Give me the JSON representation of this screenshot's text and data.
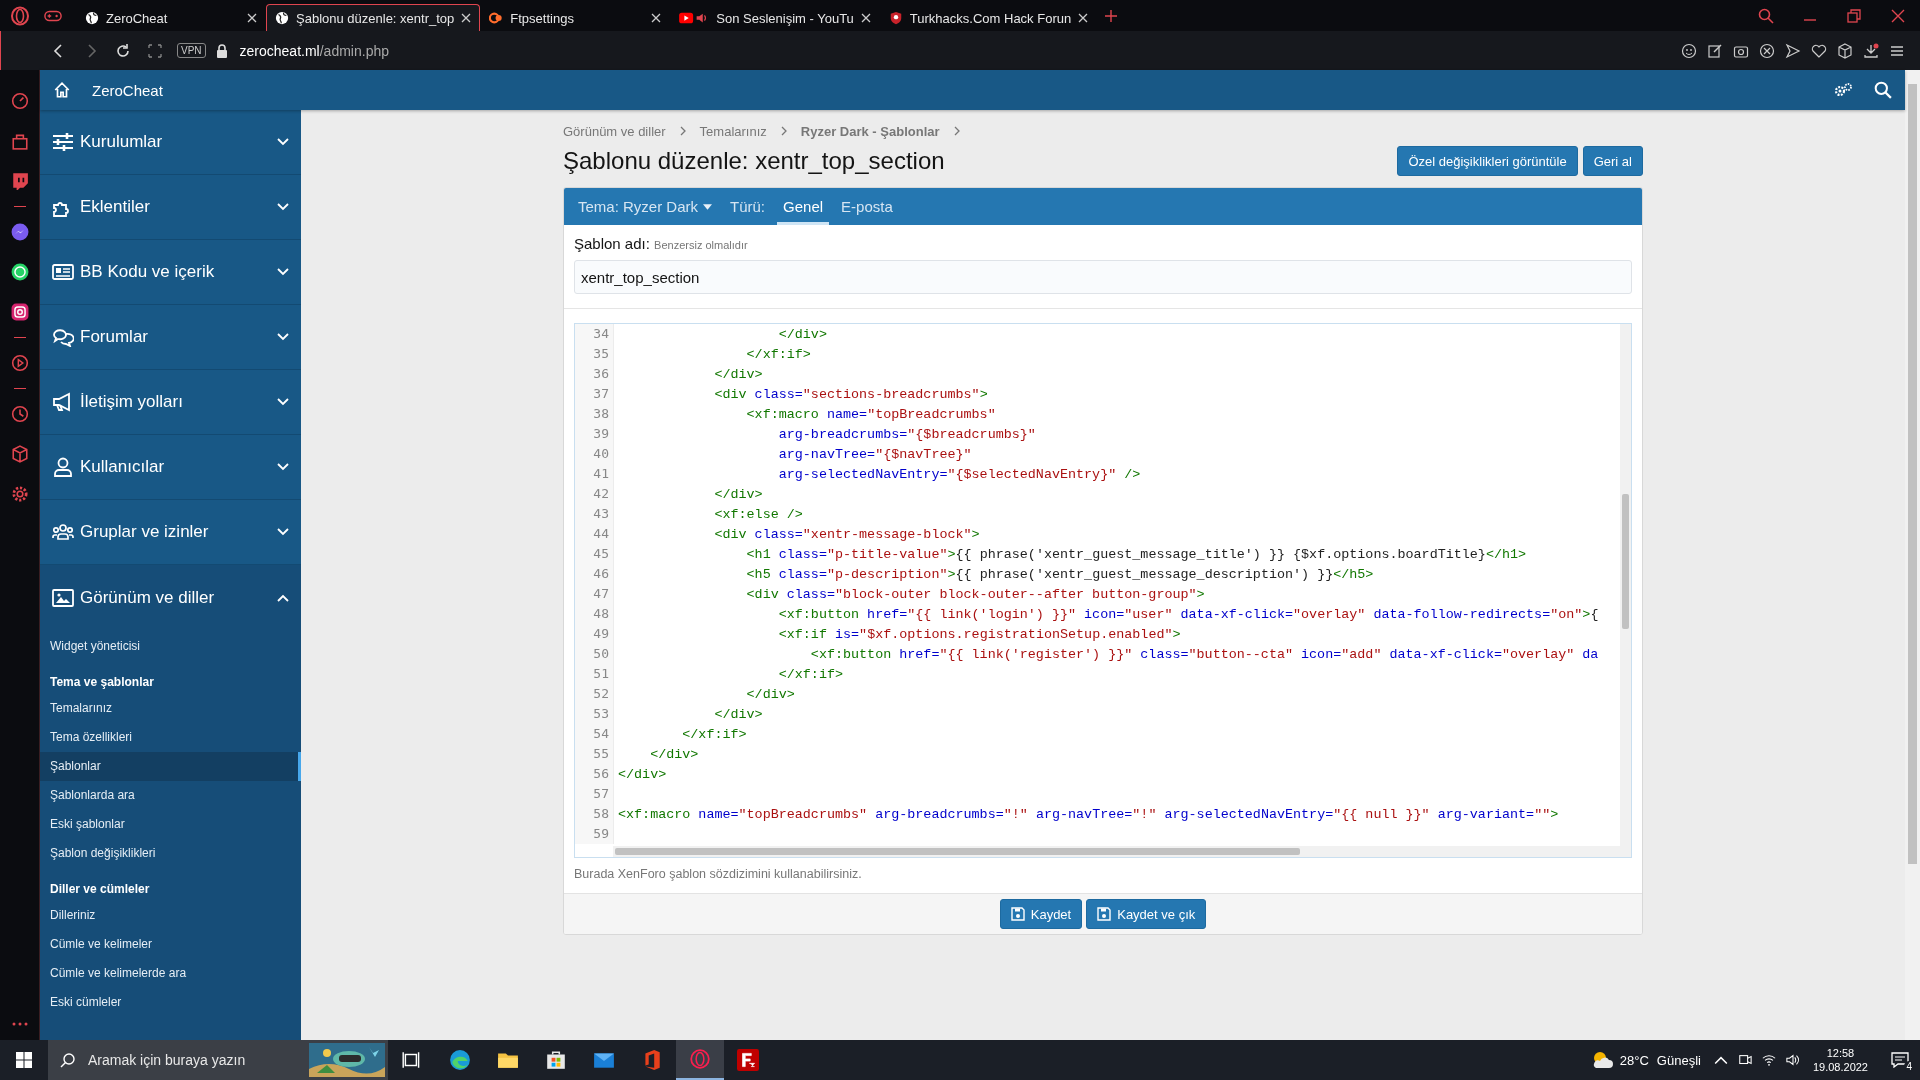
{
  "browser": {
    "tabs": [
      {
        "title": "ZeroCheat",
        "selected": false
      },
      {
        "title": "Şablonu düzenle: xentr_top",
        "selected": true
      },
      {
        "title": "Ftpsettings",
        "selected": false
      },
      {
        "title": "Son Seslenişim - YouTu",
        "selected": false
      },
      {
        "title": "Turkhacks.Com Hack Forun",
        "selected": false
      }
    ],
    "address": {
      "vpn": "VPN",
      "host": "zerocheat.ml",
      "path": "/admin.php"
    }
  },
  "header": {
    "title": "ZeroCheat"
  },
  "sidebar": {
    "sections": [
      {
        "label": "Kurulumlar",
        "expanded": false
      },
      {
        "label": "Eklentiler",
        "expanded": false
      },
      {
        "label": "BB Kodu ve içerik",
        "expanded": false
      },
      {
        "label": "Forumlar",
        "expanded": false
      },
      {
        "label": "İletişim yolları",
        "expanded": false
      },
      {
        "label": "Kullanıcılar",
        "expanded": false
      },
      {
        "label": "Gruplar ve izinler",
        "expanded": false
      },
      {
        "label": "Görünüm ve diller",
        "expanded": true,
        "children": [
          {
            "kind": "link",
            "label": "Widget yöneticisi",
            "selected": false
          },
          {
            "kind": "heading",
            "label": "Tema ve şablonlar"
          },
          {
            "kind": "link",
            "label": "Temalarınız",
            "selected": false
          },
          {
            "kind": "link",
            "label": "Tema özellikleri",
            "selected": false
          },
          {
            "kind": "link",
            "label": "Şablonlar",
            "selected": true
          },
          {
            "kind": "link",
            "label": "Şablonlarda ara",
            "selected": false
          },
          {
            "kind": "link",
            "label": "Eski şablonlar",
            "selected": false
          },
          {
            "kind": "link",
            "label": "Şablon değişiklikleri",
            "selected": false
          },
          {
            "kind": "heading",
            "label": "Diller ve cümleler"
          },
          {
            "kind": "link",
            "label": "Dilleriniz",
            "selected": false
          },
          {
            "kind": "link",
            "label": "Cümle ve kelimeler",
            "selected": false
          },
          {
            "kind": "link",
            "label": "Cümle ve kelimelerde ara",
            "selected": false
          },
          {
            "kind": "link",
            "label": "Eski cümleler",
            "selected": false
          }
        ]
      }
    ]
  },
  "breadcrumbs": [
    {
      "label": "Görünüm ve diller",
      "current": false
    },
    {
      "label": "Temalarınız",
      "current": false
    },
    {
      "label": "Ryzer Dark - Şablonlar",
      "current": true
    }
  ],
  "page_title": "Şablonu düzenle: xentr_top_section",
  "actions": [
    "Özel değişiklikleri görüntüle",
    "Geri al"
  ],
  "tabs": [
    {
      "label": "Tema: Ryzer Dark",
      "kind": "dropdown",
      "selected": false
    },
    {
      "label": "Türü:",
      "kind": "label",
      "selected": false
    },
    {
      "label": "Genel",
      "kind": "tab",
      "selected": true
    },
    {
      "label": "E-posta",
      "kind": "tab",
      "selected": false
    }
  ],
  "field": {
    "label": "Şablon adı:",
    "hint": "Benzersiz olmalıdır",
    "value": "xentr_top_section"
  },
  "code": {
    "lines": [
      {
        "no": "34",
        "tokens": [
          {
            "kind": "tag",
            "text": "                    </div>"
          }
        ]
      },
      {
        "no": "35",
        "tokens": [
          {
            "kind": "tag",
            "text": "                </xf:if>"
          }
        ]
      },
      {
        "no": "36",
        "tokens": [
          {
            "kind": "tag",
            "text": "            </div>"
          }
        ]
      },
      {
        "no": "37",
        "tokens": [
          {
            "kind": "tag",
            "text": "            <div"
          },
          {
            "kind": "attr",
            "text": " class="
          },
          {
            "kind": "str",
            "text": "\"sections-breadcrumbs\""
          },
          {
            "kind": "tag",
            "text": ">"
          }
        ]
      },
      {
        "no": "38",
        "tokens": [
          {
            "kind": "tag",
            "text": "                <xf:macro"
          },
          {
            "kind": "attr",
            "text": " name="
          },
          {
            "kind": "str",
            "text": "\"topBreadcrumbs\""
          }
        ]
      },
      {
        "no": "39",
        "tokens": [
          {
            "kind": "attr",
            "text": "                    arg-breadcrumbs="
          },
          {
            "kind": "str",
            "text": "\"{$breadcrumbs}\""
          }
        ]
      },
      {
        "no": "40",
        "tokens": [
          {
            "kind": "attr",
            "text": "                    arg-navTree="
          },
          {
            "kind": "str",
            "text": "\"{$navTree}\""
          }
        ]
      },
      {
        "no": "41",
        "tokens": [
          {
            "kind": "attr",
            "text": "                    arg-selectedNavEntry="
          },
          {
            "kind": "str",
            "text": "\"{$selectedNavEntry}\""
          },
          {
            "kind": "tag",
            "text": " />"
          }
        ]
      },
      {
        "no": "42",
        "tokens": [
          {
            "kind": "tag",
            "text": "            </div>"
          }
        ]
      },
      {
        "no": "43",
        "tokens": [
          {
            "kind": "tag",
            "text": "            <xf:else />"
          }
        ]
      },
      {
        "no": "44",
        "tokens": [
          {
            "kind": "tag",
            "text": "            <div"
          },
          {
            "kind": "attr",
            "text": " class="
          },
          {
            "kind": "str",
            "text": "\"xentr-message-block\""
          },
          {
            "kind": "tag",
            "text": ">"
          }
        ]
      },
      {
        "no": "45",
        "tokens": [
          {
            "kind": "tag",
            "text": "                <h1"
          },
          {
            "kind": "attr",
            "text": " class="
          },
          {
            "kind": "str",
            "text": "\"p-title-value\""
          },
          {
            "kind": "tag",
            "text": ">"
          },
          {
            "kind": "text",
            "text": "{{ phrase('xentr_guest_message_title') }} {$xf.options.boardTitle}"
          },
          {
            "kind": "tag",
            "text": "</h1>"
          }
        ]
      },
      {
        "no": "46",
        "tokens": [
          {
            "kind": "tag",
            "text": "                <h5"
          },
          {
            "kind": "attr",
            "text": " class="
          },
          {
            "kind": "str",
            "text": "\"p-description\""
          },
          {
            "kind": "tag",
            "text": ">"
          },
          {
            "kind": "text",
            "text": "{{ phrase('xentr_guest_message_description') }}"
          },
          {
            "kind": "tag",
            "text": "</h5>"
          }
        ]
      },
      {
        "no": "47",
        "tokens": [
          {
            "kind": "tag",
            "text": "                <div"
          },
          {
            "kind": "attr",
            "text": " class="
          },
          {
            "kind": "str",
            "text": "\"block-outer block-outer--after button-group\""
          },
          {
            "kind": "tag",
            "text": ">"
          }
        ]
      },
      {
        "no": "48",
        "tokens": [
          {
            "kind": "tag",
            "text": "                    <xf:button"
          },
          {
            "kind": "attr",
            "text": " href="
          },
          {
            "kind": "str",
            "text": "\"{{ link('login') }}\""
          },
          {
            "kind": "attr",
            "text": " icon="
          },
          {
            "kind": "str",
            "text": "\"user\""
          },
          {
            "kind": "attr",
            "text": " data-xf-click="
          },
          {
            "kind": "str",
            "text": "\"overlay\""
          },
          {
            "kind": "attr",
            "text": " data-follow-redirects="
          },
          {
            "kind": "str",
            "text": "\"on\""
          },
          {
            "kind": "tag",
            "text": ">"
          },
          {
            "kind": "text",
            "text": "{"
          }
        ]
      },
      {
        "no": "49",
        "tokens": [
          {
            "kind": "tag",
            "text": "                    <xf:if"
          },
          {
            "kind": "attr",
            "text": " is="
          },
          {
            "kind": "str",
            "text": "\"$xf.options.registrationSetup.enabled\""
          },
          {
            "kind": "tag",
            "text": ">"
          }
        ]
      },
      {
        "no": "50",
        "tokens": [
          {
            "kind": "tag",
            "text": "                        <xf:button"
          },
          {
            "kind": "attr",
            "text": " href="
          },
          {
            "kind": "str",
            "text": "\"{{ link('register') }}\""
          },
          {
            "kind": "attr",
            "text": " class="
          },
          {
            "kind": "str",
            "text": "\"button--cta\""
          },
          {
            "kind": "attr",
            "text": " icon="
          },
          {
            "kind": "str",
            "text": "\"add\""
          },
          {
            "kind": "attr",
            "text": " data-xf-click="
          },
          {
            "kind": "str",
            "text": "\"overlay\""
          },
          {
            "kind": "attr",
            "text": " da"
          }
        ]
      },
      {
        "no": "51",
        "tokens": [
          {
            "kind": "tag",
            "text": "                    </xf:if>"
          }
        ]
      },
      {
        "no": "52",
        "tokens": [
          {
            "kind": "tag",
            "text": "                </div>"
          }
        ]
      },
      {
        "no": "53",
        "tokens": [
          {
            "kind": "tag",
            "text": "            </div>"
          }
        ]
      },
      {
        "no": "54",
        "tokens": [
          {
            "kind": "tag",
            "text": "        </xf:if>"
          }
        ]
      },
      {
        "no": "55",
        "tokens": [
          {
            "kind": "tag",
            "text": "    </div>"
          }
        ]
      },
      {
        "no": "56",
        "tokens": [
          {
            "kind": "tag",
            "text": "</div>"
          }
        ]
      },
      {
        "no": "57"
      },
      {
        "no": "58",
        "tokens": [
          {
            "kind": "tag",
            "text": "<xf:macro"
          },
          {
            "kind": "attr",
            "text": " name="
          },
          {
            "kind": "str",
            "text": "\"topBreadcrumbs\""
          },
          {
            "kind": "attr",
            "text": " arg-breadcrumbs="
          },
          {
            "kind": "str",
            "text": "\"!\""
          },
          {
            "kind": "attr",
            "text": " arg-navTree="
          },
          {
            "kind": "str",
            "text": "\"!\""
          },
          {
            "kind": "attr",
            "text": " arg-selectedNavEntry="
          },
          {
            "kind": "str",
            "text": "\"{{ null }}\""
          },
          {
            "kind": "attr",
            "text": " arg-variant="
          },
          {
            "kind": "str",
            "text": "\"\""
          },
          {
            "kind": "tag",
            "text": ">"
          }
        ]
      },
      {
        "no": "59"
      }
    ]
  },
  "code_hint": "Burada XenForo şablon sözdizimini kullanabilirsiniz.",
  "footer_buttons": [
    "Kaydet",
    "Kaydet ve çık"
  ],
  "taskbar": {
    "search_placeholder": "Aramak için buraya yazın",
    "temperature": "28°C",
    "weather": "Güneşli",
    "time": "12:58",
    "date": "19.08.2022",
    "notifications": "4"
  }
}
